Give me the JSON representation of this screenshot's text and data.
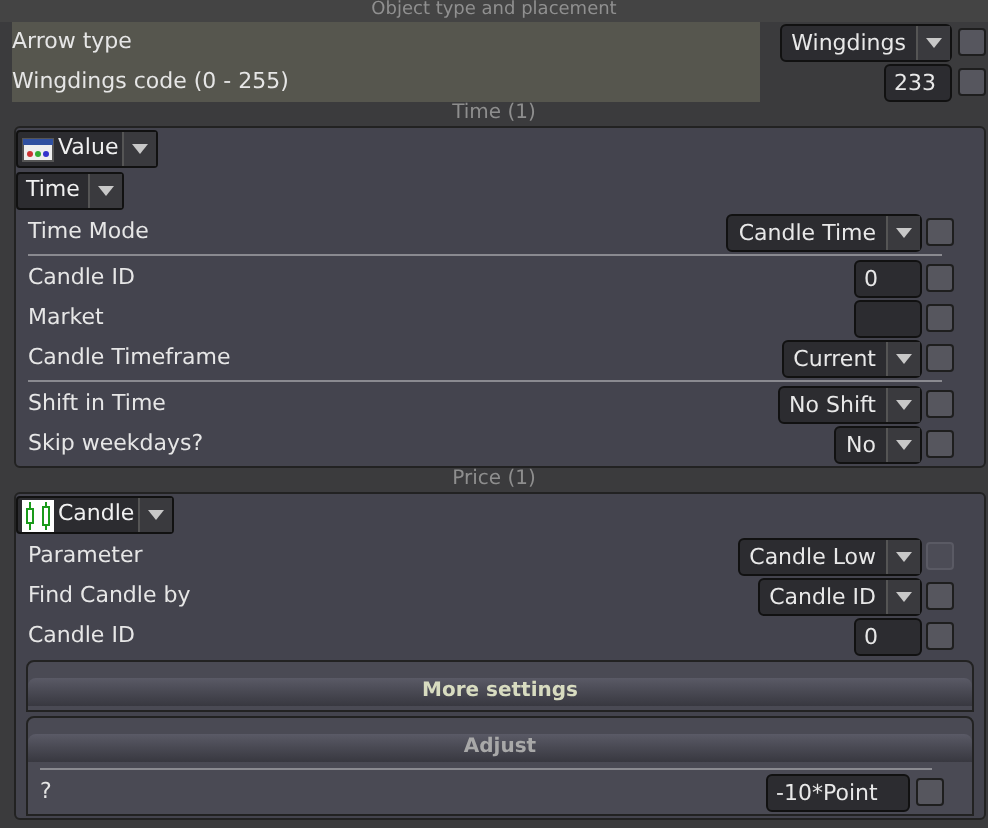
{
  "header": {
    "title": "Object type and placement"
  },
  "top": {
    "rows": [
      {
        "label": "Arrow type",
        "kind": "select",
        "value": "Wingdings",
        "checked": false,
        "disabled": false
      },
      {
        "label": "Wingdings code (0 - 255)",
        "kind": "input",
        "value": "233",
        "checked": false,
        "disabled": false
      }
    ]
  },
  "sections": [
    {
      "title": "Time (1)",
      "source": {
        "kind": "value",
        "label": "Value"
      },
      "subtype": "Time",
      "rows": [
        {
          "label": "Time Mode",
          "kind": "select",
          "value": "Candle Time",
          "checked": false,
          "disabled": false
        },
        {
          "kind": "divider"
        },
        {
          "label": "Candle ID",
          "kind": "input",
          "value": "0",
          "checked": false,
          "disabled": false
        },
        {
          "label": "Market",
          "kind": "input",
          "value": "",
          "checked": false,
          "disabled": false
        },
        {
          "label": "Candle Timeframe",
          "kind": "select",
          "value": "Current",
          "checked": false,
          "disabled": false
        },
        {
          "kind": "divider"
        },
        {
          "label": "Shift in Time",
          "kind": "select",
          "value": "No Shift",
          "checked": false,
          "disabled": false
        },
        {
          "label": "Skip weekdays?",
          "kind": "select",
          "value": "No",
          "checked": false,
          "disabled": false
        }
      ]
    },
    {
      "title": "Price (1)",
      "source": {
        "kind": "candle",
        "label": "Candle"
      },
      "rows": [
        {
          "label": "Parameter",
          "kind": "select",
          "value": "Candle Low",
          "checked": false,
          "disabled": true
        },
        {
          "label": "Find Candle by",
          "kind": "select",
          "value": "Candle ID",
          "checked": false,
          "disabled": false
        },
        {
          "label": "Candle ID",
          "kind": "input",
          "value": "0",
          "checked": false,
          "disabled": false
        }
      ],
      "groups": [
        {
          "title": "More settings",
          "expanded": false
        },
        {
          "title": "Adjust",
          "expanded": true,
          "rows": [
            {
              "kind": "divider"
            },
            {
              "label": "?",
              "kind": "input",
              "value": "-10*Point",
              "checked": false,
              "disabled": false
            }
          ]
        }
      ]
    }
  ]
}
